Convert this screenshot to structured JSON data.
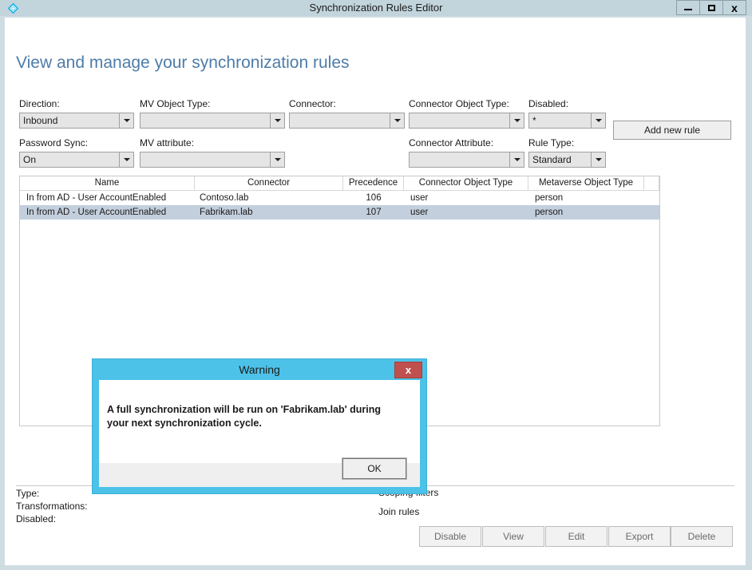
{
  "window": {
    "title": "Synchronization Rules Editor",
    "app_icon": "sync-diamond-icon",
    "minimize_label": "",
    "maximize_label": "",
    "close_label": "x"
  },
  "page": {
    "heading": "View and manage your synchronization rules"
  },
  "filters": [
    {
      "label": "Direction:",
      "value": "Inbound",
      "name": "direction"
    },
    {
      "label": "MV Object Type:",
      "value": "",
      "name": "mv-object-type"
    },
    {
      "label": "Connector:",
      "value": "",
      "name": "connector"
    },
    {
      "label": "Connector Object Type:",
      "value": "",
      "name": "connector-object-type"
    },
    {
      "label": "Disabled:",
      "value": "*",
      "name": "disabled"
    },
    {
      "label": "Password Sync:",
      "value": "On",
      "name": "password-sync"
    },
    {
      "label": "MV attribute:",
      "value": "",
      "name": "mv-attribute"
    },
    {
      "label": "Connector Attribute:",
      "value": "",
      "name": "connector-attribute"
    },
    {
      "label": "Rule Type:",
      "value": "Standard",
      "name": "rule-type"
    }
  ],
  "toolbar": {
    "add_new_rule_label": "Add new rule"
  },
  "grid": {
    "columns": [
      "Name",
      "Connector",
      "Precedence",
      "Connector Object Type",
      "Metaverse Object Type",
      ""
    ],
    "rows": [
      {
        "name": "In from AD - User AccountEnabled",
        "connector": "Contoso.lab",
        "precedence": "106",
        "connector_object_type": "user",
        "metaverse_object_type": "person",
        "selected": false
      },
      {
        "name": "In from AD - User AccountEnabled",
        "connector": "Fabrikam.lab",
        "precedence": "107",
        "connector_object_type": "user",
        "metaverse_object_type": "person",
        "selected": true
      }
    ]
  },
  "detail": {
    "left_labels": [
      "Type:",
      "Transformations:",
      "Disabled:"
    ],
    "right_labels": [
      "Scoping filters",
      "Join rules"
    ]
  },
  "actions": [
    {
      "label": "Disable",
      "name": "disable"
    },
    {
      "label": "View",
      "name": "view"
    },
    {
      "label": "Edit",
      "name": "edit"
    },
    {
      "label": "Export",
      "name": "export"
    },
    {
      "label": "Delete",
      "name": "delete"
    }
  ],
  "dialog": {
    "title": "Warning",
    "close_label": "x",
    "message": "A full synchronization will be run on 'Fabrikam.lab' during your next synchronization cycle.",
    "ok_label": "OK"
  },
  "colors": {
    "title_bar": "#c2d4dc",
    "heading_text": "#4e7ca8",
    "dialog_title_bar": "#4dc2e8",
    "dialog_close": "#c0504d",
    "row_selected": "#c3cfdc",
    "window_border": "#cfdde3"
  }
}
